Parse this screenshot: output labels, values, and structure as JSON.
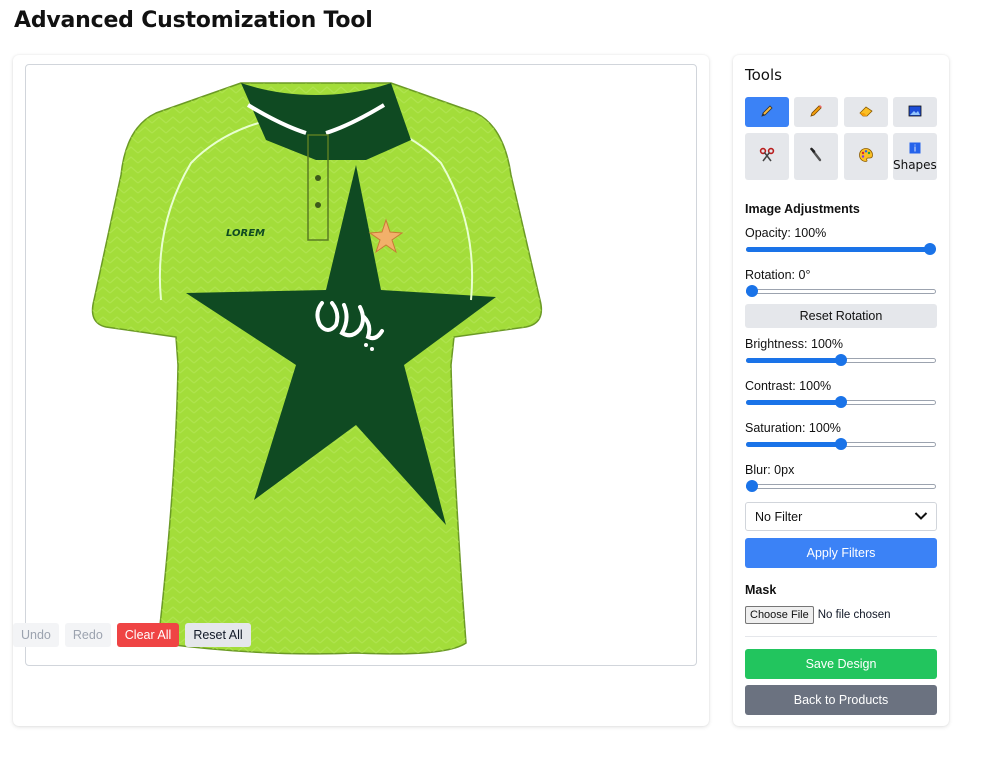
{
  "page": {
    "title": "Advanced Customization Tool"
  },
  "canvas": {
    "jersey_text": "LOREM",
    "colors": {
      "body": "#a3dd3a",
      "star": "#0f4a22",
      "collar": "#0f4a22",
      "emblem_star": "#f2b06a"
    }
  },
  "history": {
    "undo": "Undo",
    "redo": "Redo",
    "clear_all": "Clear All",
    "reset_all": "Reset All"
  },
  "tools": {
    "heading": "Tools",
    "items": [
      {
        "icon": "pencil-icon",
        "active": true
      },
      {
        "icon": "pen-icon",
        "active": false
      },
      {
        "icon": "eraser-icon",
        "active": false
      },
      {
        "icon": "image-icon",
        "active": false
      },
      {
        "icon": "scissors-icon",
        "active": false
      },
      {
        "icon": "brush-icon",
        "active": false
      },
      {
        "icon": "palette-icon",
        "active": false
      },
      {
        "icon": "shapes-icon",
        "active": false,
        "label": "Shapes"
      }
    ]
  },
  "adjustments": {
    "title": "Image Adjustments",
    "opacity": {
      "label": "Opacity: 100%",
      "fraction": 1.0
    },
    "rotation": {
      "label": "Rotation: 0°",
      "fraction": 0.0
    },
    "reset_rotation": "Reset Rotation",
    "brightness": {
      "label": "Brightness: 100%",
      "fraction": 0.5
    },
    "contrast": {
      "label": "Contrast: 100%",
      "fraction": 0.5
    },
    "saturation": {
      "label": "Saturation: 100%",
      "fraction": 0.5
    },
    "blur": {
      "label": "Blur: 0px",
      "fraction": 0.0
    },
    "filter_select": "No Filter",
    "apply_filters": "Apply Filters"
  },
  "mask": {
    "title": "Mask",
    "choose_file": "Choose File",
    "file_status": "No file chosen"
  },
  "actions": {
    "save": "Save Design",
    "back": "Back to Products"
  },
  "colors": {
    "accent": "#3b82f6",
    "slider": "#1a73e8",
    "danger": "#ef4444",
    "success": "#22c55e",
    "secondary": "#6b7280"
  }
}
